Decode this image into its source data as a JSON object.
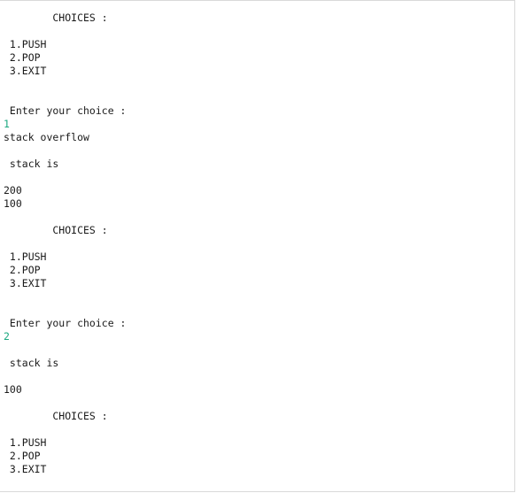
{
  "console": {
    "lines": [
      "        CHOICES :",
      "",
      " 1.PUSH",
      " 2.POP",
      " 3.EXIT",
      "",
      "",
      " Enter your choice :",
      "1",
      "stack overflow",
      "",
      " stack is",
      "",
      "200",
      "100",
      "",
      "        CHOICES :",
      "",
      " 1.PUSH",
      " 2.POP",
      " 3.EXIT",
      "",
      "",
      " Enter your choice :",
      "2",
      "",
      " stack is",
      "",
      "100",
      "",
      "        CHOICES :",
      "",
      " 1.PUSH",
      " 2.POP",
      " 3.EXIT"
    ],
    "input_line_indices": [
      8,
      24
    ],
    "colors": {
      "text": "#1a1a1a",
      "user_input": "#1ba87f",
      "background": "#ffffff"
    }
  }
}
